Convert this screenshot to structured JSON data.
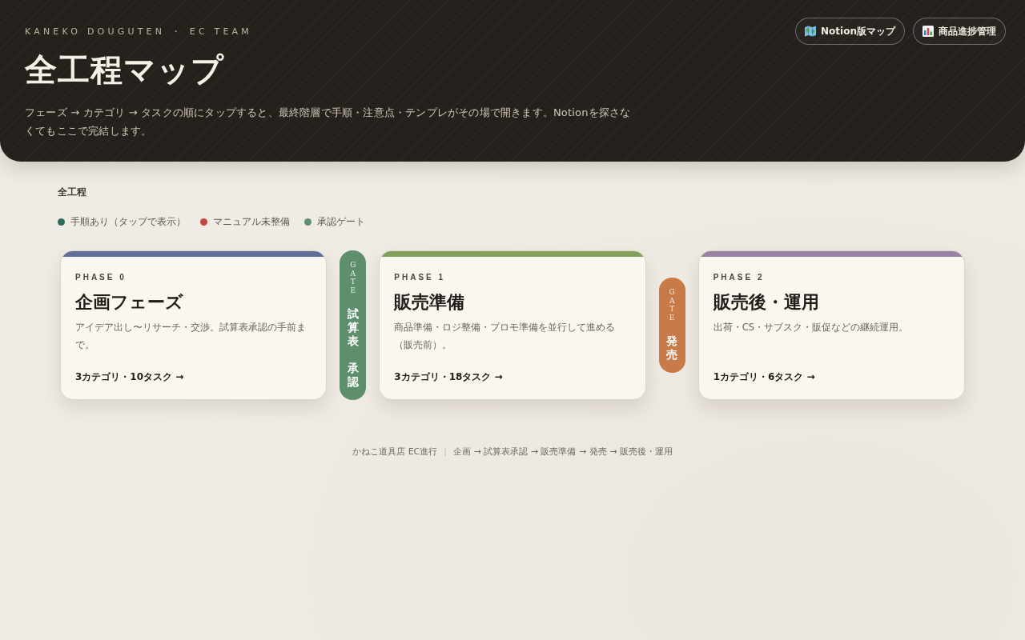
{
  "header": {
    "eyebrow": "KANEKO DOUGUTEN ・ EC TEAM",
    "title": "全工程マップ",
    "description": "フェーズ → カテゴリ → タスクの順にタップすると、最終階層で手順・注意点・テンプレがその場で開きます。Notionを探さなくてもここで完結します。",
    "links": [
      {
        "label": "Notion版マップ"
      },
      {
        "label": "商品進捗管理"
      }
    ]
  },
  "section_title": "全工程",
  "legend": [
    {
      "label": "手順あり（タップで表示）",
      "color": "#2f6b5c"
    },
    {
      "label": "マニュアル未整備",
      "color": "#c0463f"
    },
    {
      "label": "承認ゲート",
      "color": "#5b9170"
    }
  ],
  "flow": [
    {
      "kind": "phase",
      "eyebrow": "PHASE 0",
      "title": "企画フェーズ",
      "description": "アイデア出し〜リサーチ・交渉。試算表承認の手前まで。",
      "summary": "3カテゴリ・10タスク →",
      "color": "#5f6f98"
    },
    {
      "kind": "gate",
      "tag": "GATE",
      "labels": [
        "試算表",
        "承認"
      ],
      "color": "#5e8f6d"
    },
    {
      "kind": "phase",
      "eyebrow": "PHASE 1",
      "title": "販売準備",
      "description": "商品準備・ロジ整備・プロモ準備を並行して進める（販売前）。",
      "summary": "3カテゴリ・18タスク →",
      "color": "#84a05a"
    },
    {
      "kind": "gate",
      "tag": "GATE",
      "labels": [
        "発売"
      ],
      "color": "#c87a48"
    },
    {
      "kind": "phase",
      "eyebrow": "PHASE 2",
      "title": "販売後・運用",
      "description": "出荷・CS・サブスク・販促などの継続運用。",
      "summary": "1カテゴリ・6タスク →",
      "color": "#9a82a6"
    }
  ],
  "footer": {
    "brand": "かねこ道具店 EC進行",
    "separator": "|",
    "route": "企画 → 試算表承認 → 販売準備 → 発売 → 販売後・運用"
  }
}
